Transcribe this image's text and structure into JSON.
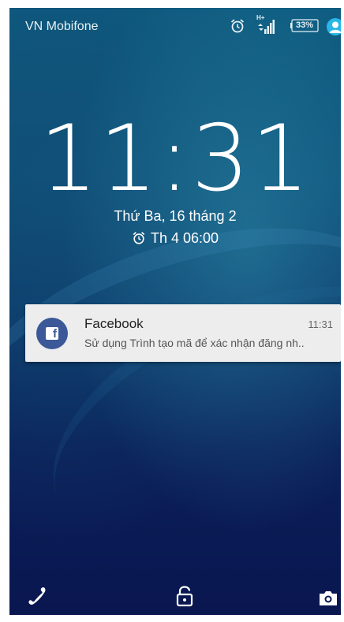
{
  "status_bar": {
    "carrier": "VN Mobifone",
    "network_type": "H+",
    "battery_level": "33%",
    "icons": [
      "alarm-icon",
      "signal-icon",
      "battery-icon",
      "account-icon"
    ]
  },
  "lock_screen": {
    "time": "11:31",
    "date": "Thứ Ba, 16 tháng 2",
    "next_alarm": "Th 4 06:00"
  },
  "notification": {
    "app": "Facebook",
    "time": "11:31",
    "text": "Sử dụng Trình tạo mã để xác nhận đăng nh..",
    "icon": "facebook-icon",
    "color": "#3b5998"
  },
  "bottom_actions": {
    "icons": [
      "phone-icon",
      "unlock-icon",
      "camera-icon"
    ]
  }
}
